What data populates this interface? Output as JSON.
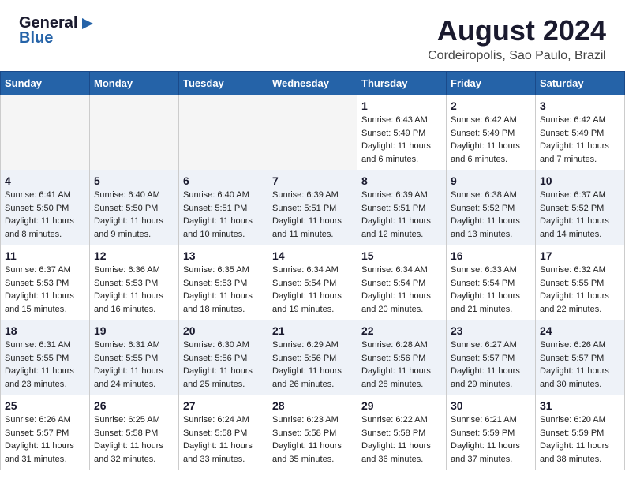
{
  "header": {
    "logo": {
      "line1": "General",
      "line2": "Blue"
    },
    "month_year": "August 2024",
    "location": "Cordeiropolis, Sao Paulo, Brazil"
  },
  "weekdays": [
    "Sunday",
    "Monday",
    "Tuesday",
    "Wednesday",
    "Thursday",
    "Friday",
    "Saturday"
  ],
  "weeks": [
    [
      {
        "day": "",
        "empty": true
      },
      {
        "day": "",
        "empty": true
      },
      {
        "day": "",
        "empty": true
      },
      {
        "day": "",
        "empty": true
      },
      {
        "day": "1",
        "sunrise": "6:43 AM",
        "sunset": "5:49 PM",
        "daylight": "Daylight: 11 hours and 6 minutes."
      },
      {
        "day": "2",
        "sunrise": "6:42 AM",
        "sunset": "5:49 PM",
        "daylight": "Daylight: 11 hours and 6 minutes."
      },
      {
        "day": "3",
        "sunrise": "6:42 AM",
        "sunset": "5:49 PM",
        "daylight": "Daylight: 11 hours and 7 minutes."
      }
    ],
    [
      {
        "day": "4",
        "sunrise": "6:41 AM",
        "sunset": "5:50 PM",
        "daylight": "Daylight: 11 hours and 8 minutes."
      },
      {
        "day": "5",
        "sunrise": "6:40 AM",
        "sunset": "5:50 PM",
        "daylight": "Daylight: 11 hours and 9 minutes."
      },
      {
        "day": "6",
        "sunrise": "6:40 AM",
        "sunset": "5:51 PM",
        "daylight": "Daylight: 11 hours and 10 minutes."
      },
      {
        "day": "7",
        "sunrise": "6:39 AM",
        "sunset": "5:51 PM",
        "daylight": "Daylight: 11 hours and 11 minutes."
      },
      {
        "day": "8",
        "sunrise": "6:39 AM",
        "sunset": "5:51 PM",
        "daylight": "Daylight: 11 hours and 12 minutes."
      },
      {
        "day": "9",
        "sunrise": "6:38 AM",
        "sunset": "5:52 PM",
        "daylight": "Daylight: 11 hours and 13 minutes."
      },
      {
        "day": "10",
        "sunrise": "6:37 AM",
        "sunset": "5:52 PM",
        "daylight": "Daylight: 11 hours and 14 minutes."
      }
    ],
    [
      {
        "day": "11",
        "sunrise": "6:37 AM",
        "sunset": "5:53 PM",
        "daylight": "Daylight: 11 hours and 15 minutes."
      },
      {
        "day": "12",
        "sunrise": "6:36 AM",
        "sunset": "5:53 PM",
        "daylight": "Daylight: 11 hours and 16 minutes."
      },
      {
        "day": "13",
        "sunrise": "6:35 AM",
        "sunset": "5:53 PM",
        "daylight": "Daylight: 11 hours and 18 minutes."
      },
      {
        "day": "14",
        "sunrise": "6:34 AM",
        "sunset": "5:54 PM",
        "daylight": "Daylight: 11 hours and 19 minutes."
      },
      {
        "day": "15",
        "sunrise": "6:34 AM",
        "sunset": "5:54 PM",
        "daylight": "Daylight: 11 hours and 20 minutes."
      },
      {
        "day": "16",
        "sunrise": "6:33 AM",
        "sunset": "5:54 PM",
        "daylight": "Daylight: 11 hours and 21 minutes."
      },
      {
        "day": "17",
        "sunrise": "6:32 AM",
        "sunset": "5:55 PM",
        "daylight": "Daylight: 11 hours and 22 minutes."
      }
    ],
    [
      {
        "day": "18",
        "sunrise": "6:31 AM",
        "sunset": "5:55 PM",
        "daylight": "Daylight: 11 hours and 23 minutes."
      },
      {
        "day": "19",
        "sunrise": "6:31 AM",
        "sunset": "5:55 PM",
        "daylight": "Daylight: 11 hours and 24 minutes."
      },
      {
        "day": "20",
        "sunrise": "6:30 AM",
        "sunset": "5:56 PM",
        "daylight": "Daylight: 11 hours and 25 minutes."
      },
      {
        "day": "21",
        "sunrise": "6:29 AM",
        "sunset": "5:56 PM",
        "daylight": "Daylight: 11 hours and 26 minutes."
      },
      {
        "day": "22",
        "sunrise": "6:28 AM",
        "sunset": "5:56 PM",
        "daylight": "Daylight: 11 hours and 28 minutes."
      },
      {
        "day": "23",
        "sunrise": "6:27 AM",
        "sunset": "5:57 PM",
        "daylight": "Daylight: 11 hours and 29 minutes."
      },
      {
        "day": "24",
        "sunrise": "6:26 AM",
        "sunset": "5:57 PM",
        "daylight": "Daylight: 11 hours and 30 minutes."
      }
    ],
    [
      {
        "day": "25",
        "sunrise": "6:26 AM",
        "sunset": "5:57 PM",
        "daylight": "Daylight: 11 hours and 31 minutes."
      },
      {
        "day": "26",
        "sunrise": "6:25 AM",
        "sunset": "5:58 PM",
        "daylight": "Daylight: 11 hours and 32 minutes."
      },
      {
        "day": "27",
        "sunrise": "6:24 AM",
        "sunset": "5:58 PM",
        "daylight": "Daylight: 11 hours and 33 minutes."
      },
      {
        "day": "28",
        "sunrise": "6:23 AM",
        "sunset": "5:58 PM",
        "daylight": "Daylight: 11 hours and 35 minutes."
      },
      {
        "day": "29",
        "sunrise": "6:22 AM",
        "sunset": "5:58 PM",
        "daylight": "Daylight: 11 hours and 36 minutes."
      },
      {
        "day": "30",
        "sunrise": "6:21 AM",
        "sunset": "5:59 PM",
        "daylight": "Daylight: 11 hours and 37 minutes."
      },
      {
        "day": "31",
        "sunrise": "6:20 AM",
        "sunset": "5:59 PM",
        "daylight": "Daylight: 11 hours and 38 minutes."
      }
    ]
  ]
}
